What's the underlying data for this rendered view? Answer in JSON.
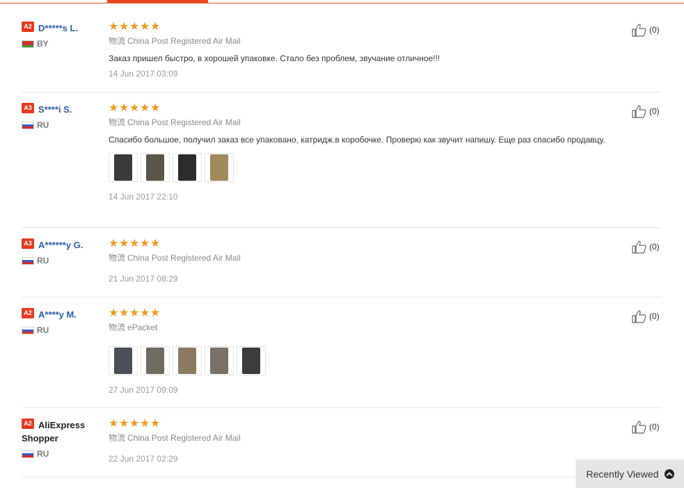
{
  "reviews": [
    {
      "level": "A2",
      "name": "D*****s L.",
      "country": "BY",
      "flag": "by",
      "rating": 5,
      "shipping_label": "物流",
      "shipping_method": "China Post Registered Air Mail",
      "text": "Заказ пришел быстро, в хорошей упаковке. Стало без проблем, звучание отличное!!!",
      "date": "14 Jun 2017 03:09",
      "helpful": "(0)",
      "photos": []
    },
    {
      "level": "A3",
      "name": "S****i S.",
      "country": "RU",
      "flag": "ru",
      "rating": 5,
      "shipping_label": "物流",
      "shipping_method": "China Post Registered Air Mail",
      "text": "Спасибо большое, получил заказ все упаковано, катридж.в коробочке. Проверю как звучит напишу. Еще раз спасибо продавцу.",
      "date": "14 Jun 2017 22:10",
      "helpful": "(0)",
      "photos": [
        "#3a3a3a",
        "#5b5448",
        "#2c2c2c",
        "#a08a5a"
      ]
    },
    {
      "level": "A3",
      "name": "A******y G.",
      "country": "RU",
      "flag": "ru",
      "rating": 5,
      "shipping_label": "物流",
      "shipping_method": "China Post Registered Air Mail",
      "text": "",
      "date": "21 Jun 2017 08:29",
      "helpful": "(0)",
      "photos": []
    },
    {
      "level": "A2",
      "name": "A****y M.",
      "country": "RU",
      "flag": "ru",
      "rating": 5,
      "shipping_label": "物流",
      "shipping_method": "ePacket",
      "text": "",
      "date": "27 Jun 2017 09:09",
      "helpful": "(0)",
      "photos": [
        "#4a4f5a",
        "#6f6a62",
        "#8a7b60",
        "#7a7068",
        "#3c3c3c"
      ]
    },
    {
      "level": "A2",
      "name": "AliExpress Shopper",
      "country": "RU",
      "flag": "ru",
      "rating": 5,
      "shipping_label": "物流",
      "shipping_method": "China Post Registered Air Mail",
      "text": "",
      "date": "22 Jun 2017 02:29",
      "helpful": "(0)",
      "photos": []
    }
  ],
  "recently_viewed": {
    "label": "Recently Viewed",
    "icon": "chevron-up-circle-icon"
  },
  "colors": {
    "accent": "#e8471c",
    "star": "#f29a1e",
    "buyer_link": "#2a5ea7",
    "level_badge": "#e33a1f"
  }
}
